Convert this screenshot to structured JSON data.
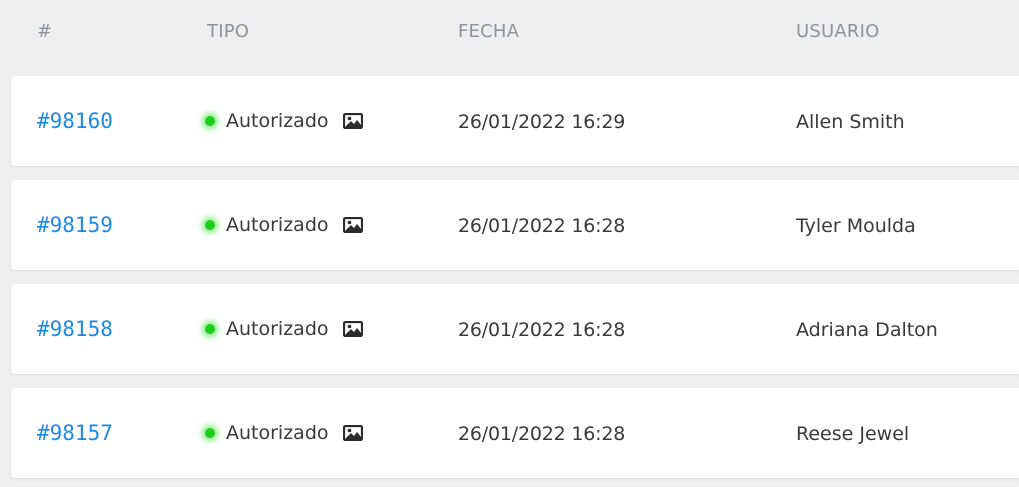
{
  "table": {
    "headers": {
      "num": "#",
      "tipo": "TIPO",
      "fecha": "FECHA",
      "usuario": "USUARIO"
    },
    "rows": [
      {
        "id": "#98160",
        "tipo": "Autorizado",
        "status_color": "#1ccf1c",
        "icon": "image-icon",
        "fecha": "26/01/2022 16:29",
        "usuario": "Allen Smith"
      },
      {
        "id": "#98159",
        "tipo": "Autorizado",
        "status_color": "#1ccf1c",
        "icon": "image-icon",
        "fecha": "26/01/2022 16:28",
        "usuario": "Tyler Moulda"
      },
      {
        "id": "#98158",
        "tipo": "Autorizado",
        "status_color": "#1ccf1c",
        "icon": "image-icon",
        "fecha": "26/01/2022 16:28",
        "usuario": "Adriana Dalton"
      },
      {
        "id": "#98157",
        "tipo": "Autorizado",
        "status_color": "#1ccf1c",
        "icon": "image-icon",
        "fecha": "26/01/2022 16:28",
        "usuario": "Reese Jewel"
      }
    ]
  },
  "colors": {
    "link": "#1e88e5",
    "header_text": "#8d949b",
    "background": "#efefef"
  }
}
